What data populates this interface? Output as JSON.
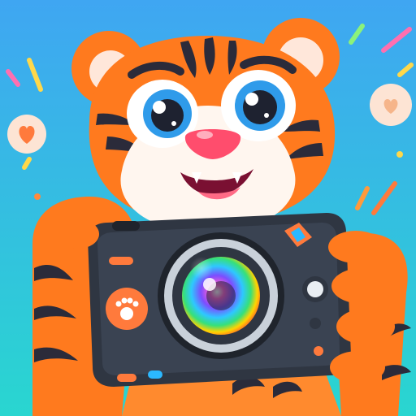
{
  "image": {
    "subject": "cartoon-tiger-holding-camera",
    "colors": {
      "bg_top": "#3FA6F2",
      "bg_bottom": "#29D6D0",
      "fur_orange": "#FF7A1E",
      "fur_orange_dark": "#F05F12",
      "fur_white": "#FFF6EF",
      "stripe": "#2B2B3A",
      "camera_body": "#2F3642",
      "camera_accent": "#FF7A3C",
      "nose": "#FF4D6D"
    },
    "icons": {
      "left_badge": "heart-icon",
      "right_badge": "heart-icon",
      "shutter_button": "paw-icon"
    }
  }
}
